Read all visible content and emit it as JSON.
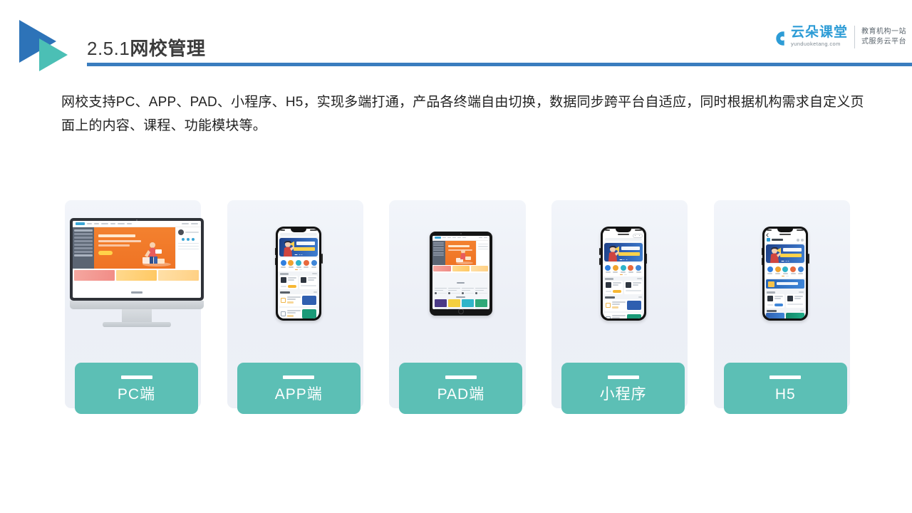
{
  "header": {
    "slide_number": "2.5.1",
    "title_cn": "网校管理",
    "rule_color": "#3a7dbf",
    "logo_icon": "double-triangle-logo"
  },
  "brand": {
    "icon": "cloud-icon",
    "name_cn": "云朵课堂",
    "domain": "yunduoketang.com",
    "tagline_line1": "教育机构一站",
    "tagline_line2": "式服务云平台",
    "color": "#2d9cd6"
  },
  "intro": {
    "paragraph": "网校支持PC、APP、PAD、小程序、H5，实现多端打通，产品各终端自由切换，数据同步跨平台自适应，同时根据机构需求自定义页面上的内容、课程、功能模块等。"
  },
  "cards": {
    "accent_color": "#5cbfb5",
    "background_color": "#eef1f7",
    "items": [
      {
        "label": "PC端",
        "device": "desktop-monitor"
      },
      {
        "label": "APP端",
        "device": "smartphone"
      },
      {
        "label": "PAD端",
        "device": "tablet"
      },
      {
        "label": "小程序",
        "device": "smartphone-miniprogram"
      },
      {
        "label": "H5",
        "device": "smartphone-browser"
      }
    ]
  }
}
